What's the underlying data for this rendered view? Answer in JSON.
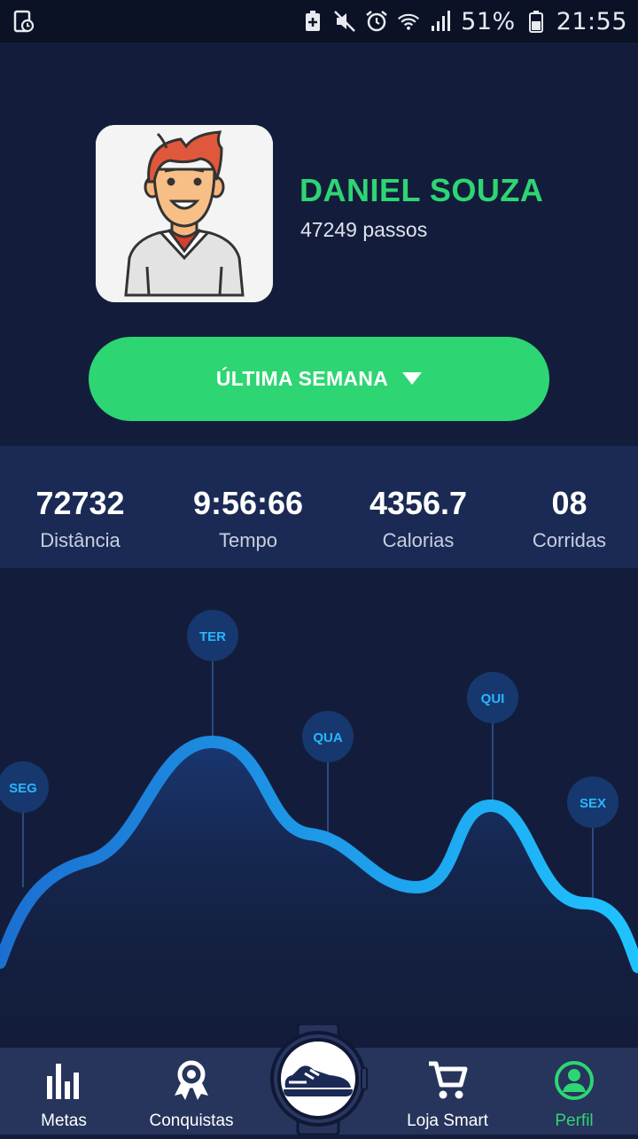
{
  "status_bar": {
    "battery_percent": "51%",
    "time": "21:55",
    "icons": [
      "screen-recorder-icon",
      "battery-saver-icon",
      "mute-icon",
      "alarm-icon",
      "wifi-icon",
      "signal-icon",
      "battery-icon"
    ]
  },
  "profile": {
    "name": "DANIEL SOUZA",
    "steps": "47249 passos",
    "avatar_icon": "user-avatar-illustration"
  },
  "period_selector": {
    "label": "ÚLTIMA SEMANA",
    "icon": "caret-down-icon"
  },
  "stats": [
    {
      "value": "72732",
      "label": "Distância"
    },
    {
      "value": "9:56:66",
      "label": "Tempo"
    },
    {
      "value": "4356.7",
      "label": "Calorias"
    },
    {
      "value": "08",
      "label": "Corridas"
    }
  ],
  "chart_data": {
    "type": "area",
    "categories": [
      "SEG",
      "TER",
      "QUA",
      "QUI",
      "SEX"
    ],
    "colors": {
      "line_start": "#1c6fd1",
      "line_end": "#1fc3ff",
      "bubble": "#17386e",
      "bubble_text": "#29b6ff"
    }
  },
  "nav": {
    "items": [
      {
        "label": "Metas",
        "icon": "bar-chart-icon"
      },
      {
        "label": "Conquistas",
        "icon": "award-ribbon-icon"
      },
      {
        "label": "Loja Smart",
        "icon": "shopping-cart-icon"
      },
      {
        "label": "Perfil",
        "icon": "person-icon"
      }
    ],
    "center_icon": "smartwatch-sneaker-icon"
  },
  "colors": {
    "accent": "#2ed573",
    "background": "#131d3b",
    "stats_bg": "#1a2a55",
    "nav_bg": "#27345c"
  }
}
